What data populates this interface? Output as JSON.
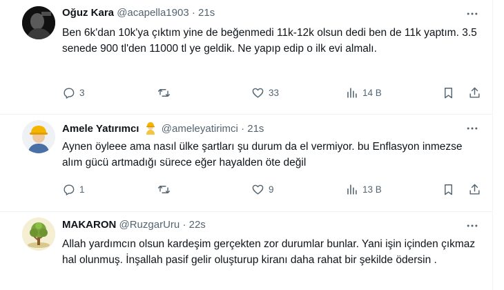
{
  "tweets": [
    {
      "name": "Oğuz Kara",
      "handle": "@acapella1903",
      "time": "21s",
      "text": "Ben 6k'dan 10k'ya çıktım yine de beğenmedi 11k-12k olsun dedi ben de 11k yaptım.  3.5 senede 900 tl'den 11000 tl ye geldik. Ne yapıp edip o ilk evi almalı.",
      "replies": "3",
      "retweets": "",
      "likes": "33",
      "views": "14 B"
    },
    {
      "name": "Amele Yatırımcı",
      "handle": "@ameleyatirimci",
      "time": "21s",
      "text": "Aynen öyleee ama nasıl ülke şartları şu durum da el vermiyor.  bu Enflasyon inmezse alım gücü artmadığı sürece eğer hayalden öte değil",
      "replies": "1",
      "retweets": "",
      "likes": "9",
      "views": "13 B"
    },
    {
      "name": "MAKARON",
      "handle": "@RuzgarUru",
      "time": "22s",
      "text": "Allah yardımcın olsun kardeşim gerçekten zor durumlar bunlar. Yani işin içinden çıkmaz hal olunmuş. İnşallah pasif gelir oluşturup kiranı daha rahat bir şekilde ödersin ."
    }
  ],
  "colors": {
    "text": "#0f1419",
    "secondary": "#536471",
    "divider": "#eff3f4"
  },
  "icons": [
    "reply-icon",
    "retweet-icon",
    "like-icon",
    "views-icon",
    "bookmark-icon",
    "share-icon",
    "more-icon"
  ]
}
